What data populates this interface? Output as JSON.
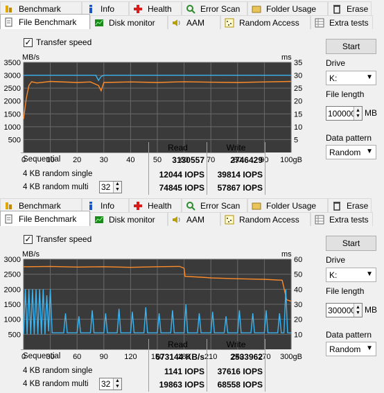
{
  "tabs_top": [
    {
      "label": "Benchmark",
      "icon": "benchmark-icon"
    },
    {
      "label": "Info",
      "icon": "info-icon"
    },
    {
      "label": "Health",
      "icon": "health-icon"
    },
    {
      "label": "Error Scan",
      "icon": "error-scan-icon"
    },
    {
      "label": "Folder Usage",
      "icon": "folder-icon"
    },
    {
      "label": "Erase",
      "icon": "trash-icon"
    }
  ],
  "tabs_bottom": [
    {
      "label": "File Benchmark",
      "icon": "file-benchmark-icon"
    },
    {
      "label": "Disk monitor",
      "icon": "disk-monitor-icon"
    },
    {
      "label": "AAM",
      "icon": "speaker-icon"
    },
    {
      "label": "Random Access",
      "icon": "random-access-icon"
    },
    {
      "label": "Extra tests",
      "icon": "extra-tests-icon"
    }
  ],
  "panels": [
    {
      "transfer_label": "Transfer speed",
      "unit_left": "MB/s",
      "unit_right": "ms",
      "y_left": [
        "3500",
        "3000",
        "2500",
        "2000",
        "1500",
        "1000",
        "500"
      ],
      "y_right": [
        "35",
        "30",
        "25",
        "20",
        "15",
        "10",
        "5"
      ],
      "x_ticks": [
        "0",
        "10",
        "20",
        "30",
        "40",
        "50",
        "60",
        "70",
        "80",
        "90",
        "100gB"
      ],
      "drive_btn": "Start",
      "drive_label": "Drive",
      "drive_value": "K:",
      "file_length_label": "File length",
      "file_length_value": "100000",
      "file_length_unit": "MB",
      "pattern_label": "Data pattern",
      "pattern_value": "Random",
      "col_read": "Read",
      "col_write": "Write",
      "rows": [
        {
          "label": "Sequential",
          "read": "3130557",
          "write": "2746429"
        },
        {
          "label": "4 KB random single",
          "read": "12044 IOPS",
          "write": "39814 IOPS"
        },
        {
          "label": "4 KB random multi",
          "read": "74845 IOPS",
          "write": "57867 IOPS"
        }
      ],
      "queue_depth": "32"
    },
    {
      "transfer_label": "Transfer speed",
      "unit_left": "MB/s",
      "unit_right": "ms",
      "y_left": [
        "3000",
        "2500",
        "2000",
        "1500",
        "1000",
        "500"
      ],
      "y_right": [
        "60",
        "50",
        "40",
        "30",
        "20",
        "10"
      ],
      "x_ticks": [
        "0",
        "30",
        "60",
        "90",
        "120",
        "150",
        "180",
        "210",
        "240",
        "270",
        "300gB"
      ],
      "drive_btn": "Start",
      "drive_label": "Drive",
      "drive_value": "K:",
      "file_length_label": "File length",
      "file_length_value": "300000",
      "file_length_unit": "MB",
      "pattern_label": "Data pattern",
      "pattern_value": "Random",
      "col_read": "Read",
      "col_write": "Write",
      "rows": [
        {
          "label": "Sequential",
          "read": "673144 KB/s",
          "write": "2533962"
        },
        {
          "label": "4 KB random single",
          "read": "1141 IOPS",
          "write": "37616 IOPS"
        },
        {
          "label": "4 KB random multi",
          "read": "19863 IOPS",
          "write": "68558 IOPS"
        }
      ],
      "queue_depth": "32"
    }
  ],
  "chart_data": [
    {
      "type": "line",
      "xlabel": "",
      "ylabel": "MB/s",
      "y2label": "ms",
      "xlim": [
        0,
        100
      ],
      "ylim": [
        0,
        3500
      ],
      "y2lim": [
        0,
        35
      ],
      "series": [
        {
          "color": "#ff8c2a",
          "x": [
            0,
            1,
            2,
            3,
            5,
            10,
            20,
            25,
            28,
            29,
            30,
            40,
            50,
            60,
            70,
            80,
            90,
            100
          ],
          "y": [
            1300,
            2100,
            2600,
            2750,
            2700,
            2760,
            2720,
            2740,
            2600,
            2400,
            2720,
            2740,
            2720,
            2750,
            2730,
            2720,
            2740,
            2760
          ]
        },
        {
          "color": "#3ab4f2",
          "x": [
            0,
            10,
            20,
            27,
            28,
            29,
            30,
            40,
            50,
            60,
            70,
            80,
            90,
            100
          ],
          "y": [
            3000,
            3000,
            3000,
            3000,
            2800,
            2950,
            3000,
            3000,
            3000,
            3000,
            3000,
            3000,
            3000,
            3000
          ]
        }
      ]
    },
    {
      "type": "line",
      "xlabel": "",
      "ylabel": "MB/s",
      "y2label": "ms",
      "xlim": [
        0,
        300
      ],
      "ylim": [
        0,
        3000
      ],
      "y2lim": [
        0,
        60
      ],
      "series": [
        {
          "color": "#ff8c2a",
          "x": [
            0,
            5,
            30,
            60,
            90,
            120,
            150,
            175,
            180,
            181,
            200,
            210,
            240,
            270,
            290,
            295,
            300
          ],
          "y": [
            2750,
            2750,
            2760,
            2740,
            2750,
            2730,
            2750,
            2760,
            2700,
            2430,
            2400,
            2380,
            2350,
            2330,
            2300,
            1650,
            1600
          ]
        },
        {
          "color": "#3ab4f2",
          "x": [
            0,
            2,
            4,
            6,
            8,
            10,
            12,
            14,
            16,
            18,
            20,
            22,
            24,
            26,
            28,
            30,
            32,
            45,
            47,
            49,
            60,
            62,
            64,
            75,
            77,
            79,
            90,
            92,
            94,
            105,
            107,
            109,
            120,
            122,
            124,
            135,
            137,
            139,
            150,
            152,
            154,
            165,
            167,
            169,
            180,
            182,
            184,
            195,
            197,
            199,
            210,
            212,
            214,
            225,
            227,
            229,
            240,
            242,
            244,
            255,
            257,
            259,
            270,
            272,
            274,
            285,
            287,
            289,
            292,
            294,
            296,
            300
          ],
          "y": [
            500,
            2000,
            500,
            2000,
            500,
            2000,
            500,
            2000,
            500,
            2000,
            500,
            2000,
            500,
            1800,
            600,
            2000,
            550,
            550,
            1200,
            550,
            550,
            1100,
            550,
            550,
            1300,
            550,
            550,
            1200,
            550,
            550,
            1350,
            550,
            550,
            1250,
            550,
            550,
            1400,
            550,
            550,
            1200,
            550,
            550,
            1300,
            550,
            550,
            1500,
            550,
            550,
            1200,
            550,
            550,
            1250,
            550,
            550,
            1100,
            550,
            550,
            1300,
            550,
            550,
            1200,
            550,
            550,
            1300,
            550,
            550,
            1200,
            550,
            550,
            2000,
            550,
            550
          ]
        }
      ]
    }
  ]
}
